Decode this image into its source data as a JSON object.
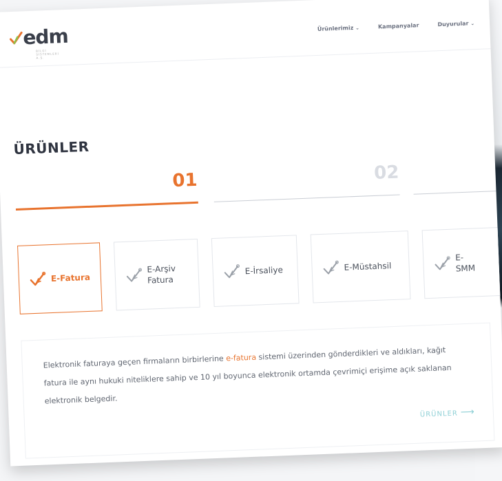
{
  "header": {
    "logo_text": "edm",
    "logo_tagline": "BİLGİ SİSTEMLERİ A.Ş.",
    "nav": [
      {
        "label": "Ürünlerimiz",
        "has_dropdown": true
      },
      {
        "label": "Kampanyalar",
        "has_dropdown": false
      },
      {
        "label": "Duyurular",
        "has_dropdown": true
      }
    ]
  },
  "products_section": {
    "title": "ÜRÜNLER",
    "steps": [
      {
        "number": "01",
        "active": true
      },
      {
        "number": "02",
        "active": false
      }
    ],
    "tiles": [
      {
        "label": "E-Fatura",
        "icon": "checkmark-leaf-icon",
        "active": true
      },
      {
        "label": "E-Arşiv Fatura",
        "icon": "checkmark-leaf-icon",
        "active": false
      },
      {
        "label": "E-İrsaliye",
        "icon": "checkmark-leaf-icon",
        "active": false
      },
      {
        "label": "E-Müstahsil",
        "icon": "checkmark-leaf-icon",
        "active": false
      },
      {
        "label": "E-SMM",
        "icon": "checkmark-leaf-icon",
        "active": false
      }
    ]
  },
  "description": {
    "text_before": "Elektronik faturaya geçen firmaların birbirlerine ",
    "highlight": "e-fatura",
    "text_after": " sistemi üzerinden gönderdikleri ve aldıkları, kağıt fatura ile aynı hukuki niteliklere sahip ve 10 yıl boyunca elektronik ortamda çevrimiçi erişime açık saklanan elektronik belgedir.",
    "link_label": "ÜRÜNLER",
    "link_arrow": "⟶"
  },
  "colors": {
    "accent": "#e8732e",
    "link": "#8fd0d6",
    "text": "#5f6570"
  }
}
